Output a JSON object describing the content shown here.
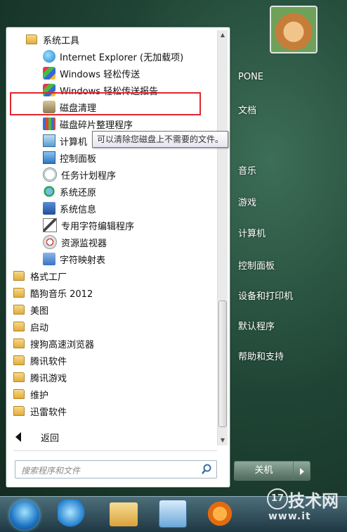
{
  "start_menu": {
    "programs": [
      {
        "label": "系统工具",
        "icon": "folder-icon",
        "indent": 1
      },
      {
        "label": "Internet Explorer (无加载项)",
        "icon": "ie-icon",
        "indent": 2
      },
      {
        "label": "Windows 轻松传送",
        "icon": "windows-easy-transfer-icon",
        "indent": 2
      },
      {
        "label": "Windows 轻松传送报告",
        "icon": "windows-easy-transfer-report-icon",
        "indent": 2
      },
      {
        "label": "磁盘清理",
        "icon": "disk-cleanup-icon",
        "indent": 2
      },
      {
        "label": "磁盘碎片整理程序",
        "icon": "disk-defragmenter-icon",
        "indent": 2
      },
      {
        "label": "计算机",
        "icon": "computer-icon",
        "indent": 2
      },
      {
        "label": "控制面板",
        "icon": "control-panel-icon",
        "indent": 2
      },
      {
        "label": "任务计划程序",
        "icon": "task-scheduler-icon",
        "indent": 2
      },
      {
        "label": "系统还原",
        "icon": "system-restore-icon",
        "indent": 2
      },
      {
        "label": "系统信息",
        "icon": "system-info-icon",
        "indent": 2
      },
      {
        "label": "专用字符编辑程序",
        "icon": "char-editor-icon",
        "indent": 2
      },
      {
        "label": "资源监视器",
        "icon": "resource-monitor-icon",
        "indent": 2
      },
      {
        "label": "字符映射表",
        "icon": "character-map-icon",
        "indent": 2
      },
      {
        "label": "格式工厂",
        "icon": "folder-icon",
        "indent": 0
      },
      {
        "label": "酷狗音乐 2012",
        "icon": "folder-icon",
        "indent": 0
      },
      {
        "label": "美图",
        "icon": "folder-icon",
        "indent": 0
      },
      {
        "label": "启动",
        "icon": "folder-icon",
        "indent": 0
      },
      {
        "label": "搜狗高速浏览器",
        "icon": "folder-icon",
        "indent": 0
      },
      {
        "label": "腾讯软件",
        "icon": "folder-icon",
        "indent": 0
      },
      {
        "label": "腾讯游戏",
        "icon": "folder-icon",
        "indent": 0
      },
      {
        "label": "维护",
        "icon": "folder-icon",
        "indent": 0
      },
      {
        "label": "迅雷软件",
        "icon": "folder-icon",
        "indent": 0
      }
    ],
    "back_label": "返回",
    "search_placeholder": "搜索程序和文件",
    "tooltip": "可以清除您磁盘上不需要的文件。",
    "highlighted_item": "磁盘清理",
    "highlight_color": "#e0262e"
  },
  "right_panel": {
    "user_name": "PONE",
    "links": [
      "文档",
      "音乐",
      "游戏",
      "计算机",
      "控制面板",
      "设备和打印机",
      "默认程序",
      "帮助和支持"
    ],
    "shutdown_label": "关机"
  },
  "watermark": {
    "badge": "17",
    "text": "技术网",
    "url": "www.it"
  }
}
